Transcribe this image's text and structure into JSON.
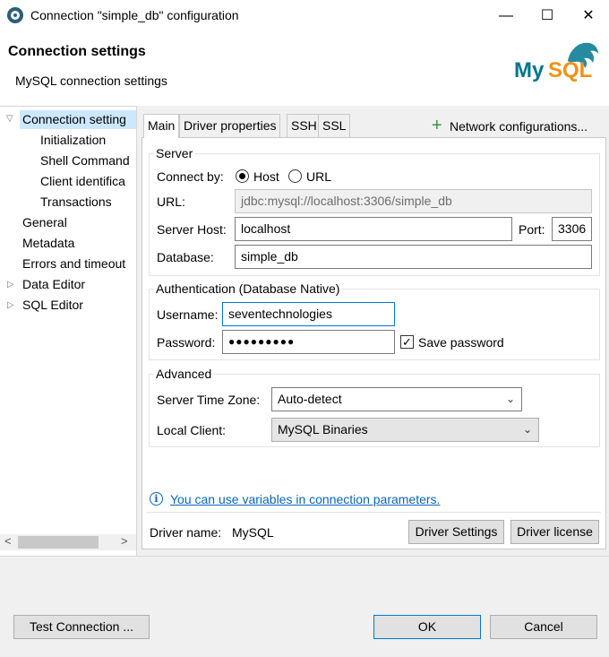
{
  "window": {
    "title": "Connection \"simple_db\" configuration",
    "minimize_label": "—",
    "maximize_label": "☐",
    "close_label": "✕"
  },
  "header": {
    "title": "Connection settings",
    "subtitle": "MySQL connection settings",
    "logo_text": "MySQL"
  },
  "nav": {
    "items": [
      {
        "label": "Connection setting"
      },
      {
        "label": "Initialization"
      },
      {
        "label": "Shell Command"
      },
      {
        "label": "Client identifica"
      },
      {
        "label": "Transactions"
      },
      {
        "label": "General"
      },
      {
        "label": "Metadata"
      },
      {
        "label": "Errors and timeout"
      },
      {
        "label": "Data Editor"
      },
      {
        "label": "SQL Editor"
      }
    ],
    "scroll_left": "<",
    "scroll_right": ">"
  },
  "tabs": {
    "items": [
      {
        "label": "Main"
      },
      {
        "label": "Driver properties"
      },
      {
        "label": "SSH"
      },
      {
        "label": "SSL"
      }
    ],
    "network_config": "Network configurations...",
    "network_plus": "+"
  },
  "server": {
    "group_title": "Server",
    "connect_by_label": "Connect by:",
    "radio_host": "Host",
    "radio_url": "URL",
    "url_label": "URL:",
    "url_value": "jdbc:mysql://localhost:3306/simple_db",
    "host_label": "Server Host:",
    "host_value": "localhost",
    "port_label": "Port:",
    "port_value": "3306",
    "database_label": "Database:",
    "database_value": "simple_db"
  },
  "auth": {
    "group_title": "Authentication (Database Native)",
    "username_label": "Username:",
    "username_value": "seventechnologies",
    "password_label": "Password:",
    "password_value": "●●●●●●●●●",
    "save_password_label": "Save password",
    "save_password_checked": "✓"
  },
  "advanced": {
    "group_title": "Advanced",
    "timezone_label": "Server Time Zone:",
    "timezone_value": "Auto-detect",
    "client_label": "Local Client:",
    "client_value": "MySQL Binaries"
  },
  "footer_panel": {
    "info_icon": "i",
    "variables_link": "You can use variables in connection parameters.",
    "driver_name_label": "Driver name:",
    "driver_name_value": "MySQL",
    "driver_settings_button": "Driver Settings",
    "driver_license_button": "Driver license"
  },
  "buttons": {
    "test_connection": "Test Connection ...",
    "ok": "OK",
    "cancel": "Cancel"
  },
  "colors": {
    "accent": "#0078d7",
    "link": "#0a64b8",
    "selection": "#cce8ff",
    "mysql_blue": "#00758f",
    "mysql_orange": "#f29111"
  }
}
